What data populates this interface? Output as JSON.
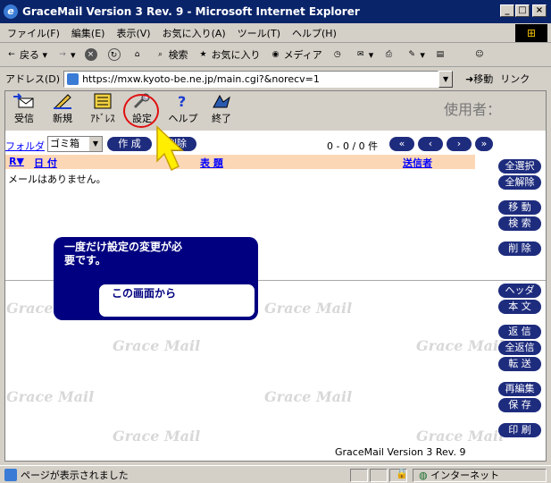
{
  "window": {
    "title": "GraceMail Version 3 Rev. 9 - Microsoft Internet Explorer",
    "min_label": "_",
    "max_label": "□",
    "close_label": "×"
  },
  "menu": [
    "ファイル(F)",
    "編集(E)",
    "表示(V)",
    "お気に入り(A)",
    "ツール(T)",
    "ヘルプ(H)"
  ],
  "toolbar": {
    "back": "戻る",
    "search": "検索",
    "favorites": "お気に入り",
    "media": "メディア"
  },
  "address": {
    "label": "アドレス(D)",
    "url": "https://mxw.kyoto-be.ne.jp/main.cgi?&norecv=1",
    "go": "移動",
    "links": "リンク"
  },
  "app": {
    "buttons": [
      "受信",
      "新規",
      "ｱﾄﾞﾚｽ",
      "設定",
      "ヘルプ",
      "終了"
    ],
    "user_label": "使用者："
  },
  "list": {
    "folder_label": "フォルダ",
    "folder_value": "ゴミ箱",
    "create_btn": "作 成",
    "delete_btn": "削除",
    "count": "0 - 0 / 0 件",
    "nav": [
      "«",
      "‹",
      "›",
      "»"
    ],
    "headers": {
      "r": "R▼",
      "date": "日 付",
      "subject": "表 題",
      "sender": "送信者"
    },
    "empty_message": "メールはありません。"
  },
  "side_buttons": [
    "全選択",
    "全解除",
    "移 動",
    "検 索",
    "削 除",
    "ヘッダ",
    "本 文",
    "返 信",
    "全返信",
    "転 送",
    "再編集",
    "保 存",
    "印 刷"
  ],
  "watermark": "Grace Mail",
  "footer": "GraceMail Version 3 Rev. 9",
  "callout": {
    "text": "一度だけ設定の変更が必要です。",
    "subtext": "この画面から"
  },
  "status": {
    "text": "ページが表示されました",
    "zone": "インターネット"
  },
  "colors": {
    "titlebar": "#0a246a",
    "pill": "#1e2c7e",
    "header_row": "#fcd7b6",
    "callout": "#000080",
    "highlight_circle": "#e01010",
    "arrow": "#ffee00"
  }
}
